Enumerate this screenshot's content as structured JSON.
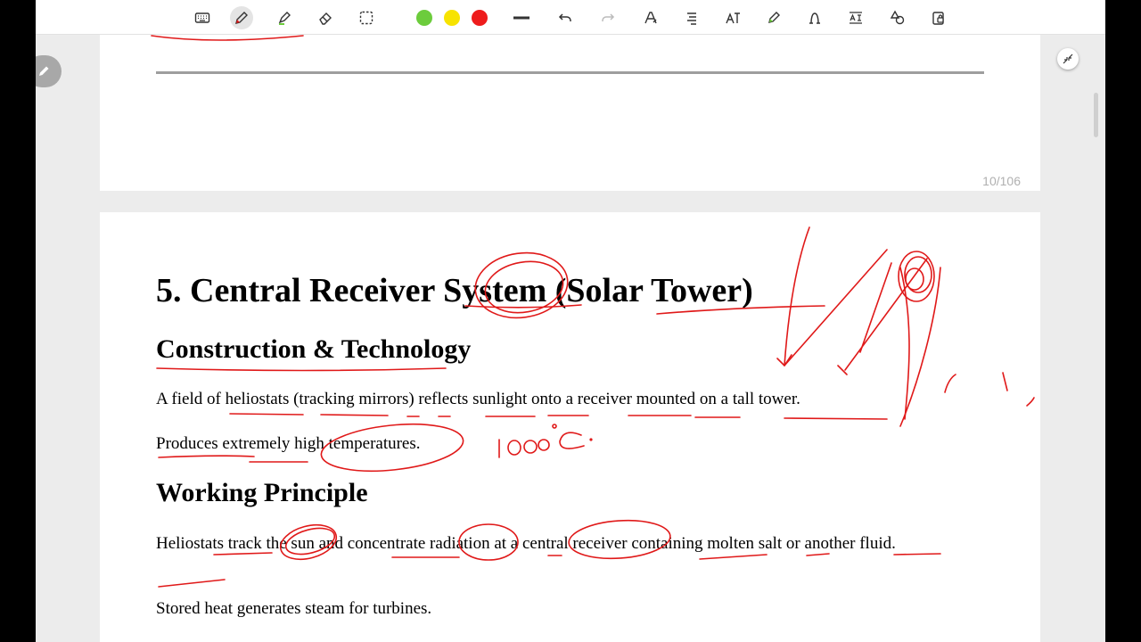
{
  "toolbar": {
    "tools": [
      {
        "name": "keyboard-icon"
      },
      {
        "name": "pen-icon",
        "active": true
      },
      {
        "name": "highlighter-icon"
      },
      {
        "name": "eraser-icon"
      },
      {
        "name": "lasso-select-icon"
      },
      {
        "name": "color-green"
      },
      {
        "name": "color-yellow"
      },
      {
        "name": "color-red"
      },
      {
        "name": "stroke-width-icon"
      },
      {
        "name": "undo-icon"
      },
      {
        "name": "redo-icon"
      },
      {
        "name": "text-pen-icon"
      },
      {
        "name": "convert-to-text-icon"
      },
      {
        "name": "text-style-icon"
      },
      {
        "name": "marker-icon"
      },
      {
        "name": "shape-pen-icon"
      },
      {
        "name": "text-recognition-icon"
      },
      {
        "name": "shapes-icon"
      },
      {
        "name": "lock-icon"
      }
    ],
    "colors": {
      "green": "#6ccc3c",
      "yellow": "#f7e300",
      "red": "#ee1c1c"
    }
  },
  "page_counter": "10/106",
  "document": {
    "title": "5. Central Receiver System (Solar Tower)",
    "section1_heading": "Construction & Technology",
    "section1_p1": "A field of heliostats (tracking mirrors) reflects sunlight onto a receiver mounted on a tall tower.",
    "section1_p2": "Produces extremely high temperatures.",
    "section2_heading": "Working Principle",
    "section2_p1": "Heliostats track the sun and concentrate radiation at a central receiver containing molten salt or another fluid.",
    "section2_p2": "Stored heat generates steam for turbines."
  },
  "annotations": {
    "handwritten_note": "1000°C",
    "ink_color": "#e01919"
  }
}
